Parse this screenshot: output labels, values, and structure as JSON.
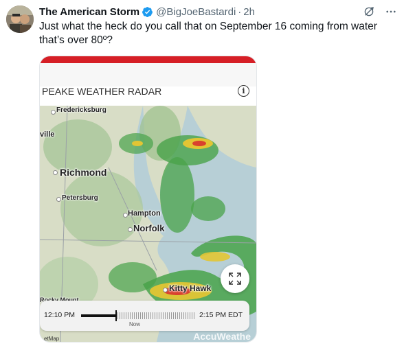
{
  "post": {
    "author_name": "The American Storm",
    "author_handle": "@BigJoeBastardi",
    "separator": "·",
    "time": "2h",
    "text": "Just what the heck do you call that on September 16 coming from water that’s over 80º?",
    "verified_color": "#1d9bf0"
  },
  "media": {
    "radar_title": "PEAKE WEATHER RADAR",
    "info_icon": "info-icon",
    "expand_icon": "expand-icon",
    "map_labels": {
      "fredericksburg": "Fredericksburg",
      "ville": "ville",
      "richmond": "Richmond",
      "petersburg": "Petersburg",
      "hampton": "Hampton",
      "norfolk": "Norfolk",
      "kitty_hawk": "Kitty Hawk",
      "rocky_mount": "Rocky Mount"
    },
    "timeline": {
      "start_time": "12:10 PM",
      "end_time": "2:15 PM EDT",
      "now_label": "Now",
      "progress": 0.3
    },
    "watermark": "AccuWeathe",
    "bottom_left": "etMap"
  }
}
